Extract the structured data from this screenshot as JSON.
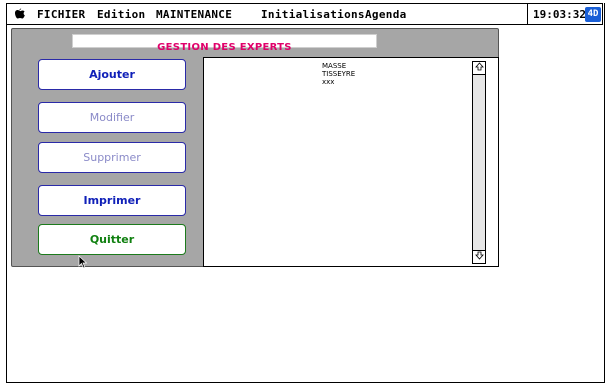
{
  "menubar": {
    "apple_icon": "apple-icon",
    "items": [
      "FICHIER",
      "Edition",
      "MAINTENANCE",
      "Initialisations",
      "Agenda"
    ],
    "clock": "19:03:32",
    "app_icon": "4D"
  },
  "dialog": {
    "title": "GESTION DES EXPERTS",
    "buttons": {
      "add": "Ajouter",
      "modify": "Modifier",
      "delete": "Supprimer",
      "print": "Imprimer",
      "quit": "Quitter"
    },
    "list_items": [
      "MASSE",
      "TISSEYRE",
      "xxx"
    ]
  },
  "colors": {
    "title": "#e0006a",
    "button_text": "#1020b8",
    "button_disabled": "#8a8ac8",
    "quit_text": "#108010",
    "window_bg": "#a6a6a6"
  }
}
